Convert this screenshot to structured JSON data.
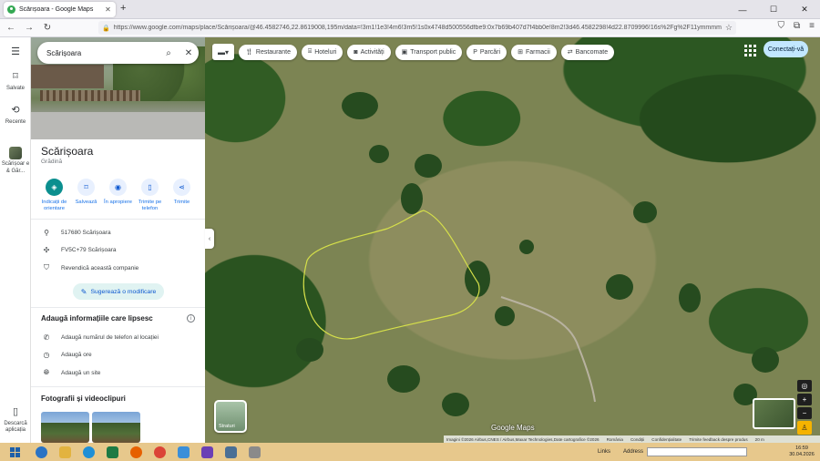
{
  "browser": {
    "tab_title": "Scărișoara - Google Maps",
    "url": "https://www.google.com/maps/place/Scărișoara/@46.4582746,22.8619008,195m/data=!3m1!1e3!4m6!3m5!1s0x4748d500556dfbe9:0x7b69b407d7f4bb0e!8m2!3d46.4582298!4d22.8709996!16s%2Fg%2F11ymmmmbh0?entry=ttu"
  },
  "sidenav": {
    "saved_label": "Salvate",
    "recent_label": "Recente",
    "place_label": "Scărișoar e & Găr...",
    "download_label": "Descarcă aplicația"
  },
  "search": {
    "value": "Scărișoara"
  },
  "place": {
    "title": "Scărișoara",
    "category": "Grădină",
    "actions": [
      {
        "label": "Indicații de orientare"
      },
      {
        "label": "Salvează"
      },
      {
        "label": "În apropiere"
      },
      {
        "label": "Trimite pe telefon"
      },
      {
        "label": "Trimite"
      }
    ],
    "address": "517680 Scărișoara",
    "plus_code": "FV5C+79 Scărișoara",
    "claim": "Revendică această companie",
    "suggest_button": "Sugerează o modificare"
  },
  "missing": {
    "title": "Adaugă informațiile care lipsesc",
    "items": [
      {
        "label": "Adaugă numărul de telefon al locației"
      },
      {
        "label": "Adaugă ore"
      },
      {
        "label": "Adaugă un site"
      }
    ]
  },
  "photos": {
    "title": "Fotografii și videoclipuri"
  },
  "map": {
    "chips": [
      {
        "label": "Restaurante",
        "icon": "fork-knife-icon"
      },
      {
        "label": "Hoteluri",
        "icon": "bed-icon"
      },
      {
        "label": "Activități",
        "icon": "camera-icon"
      },
      {
        "label": "Transport public",
        "icon": "bus-icon"
      },
      {
        "label": "Parcări",
        "icon": "parking-icon"
      },
      {
        "label": "Farmacii",
        "icon": "pharmacy-icon"
      },
      {
        "label": "Bancomate",
        "icon": "atm-icon"
      }
    ],
    "signin_label": "Conectați-vă",
    "layers_label": "Straturi",
    "logo_text": "Google Maps",
    "attribution": "Imagini ©2026 Airbus,CNES / Airbus,Maxar Technologies,Date cartografice ©2026",
    "links": [
      "România",
      "Condiții",
      "Confidențialitate",
      "Trimite feedback despre produs"
    ],
    "scale_label": "20 m",
    "outline_color": "#d6e04a"
  },
  "taskbar": {
    "links_label": "Links",
    "address_label": "Address",
    "time": "16:59",
    "date": "30.04.2026"
  }
}
